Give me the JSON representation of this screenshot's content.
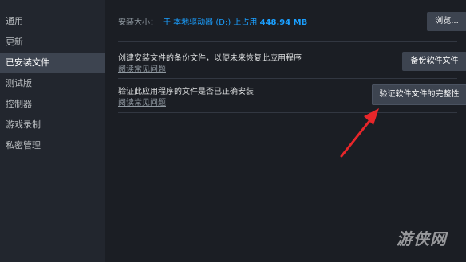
{
  "sidebar": {
    "items": [
      {
        "label": "通用"
      },
      {
        "label": "更新"
      },
      {
        "label": "已安装文件"
      },
      {
        "label": "测试版"
      },
      {
        "label": "控制器"
      },
      {
        "label": "游戏录制"
      },
      {
        "label": "私密管理"
      }
    ],
    "active_index": 2
  },
  "install_size": {
    "label": "安装大小：",
    "location_text": "于 本地驱动器 (D:) 上占用",
    "size": "448.94 MB",
    "browse_label": "浏览..."
  },
  "backup": {
    "title": "创建安装文件的备份文件，以便未来恢复此应用程序",
    "link": "阅读常见问题",
    "button_label": "备份软件文件"
  },
  "verify": {
    "title": "验证此应用程序的文件是否已正确安装",
    "link": "阅读常见问题",
    "button_label": "验证软件文件的完整性"
  },
  "annotation": {
    "color": "#e8262a"
  },
  "watermark": {
    "text": "游侠网"
  }
}
